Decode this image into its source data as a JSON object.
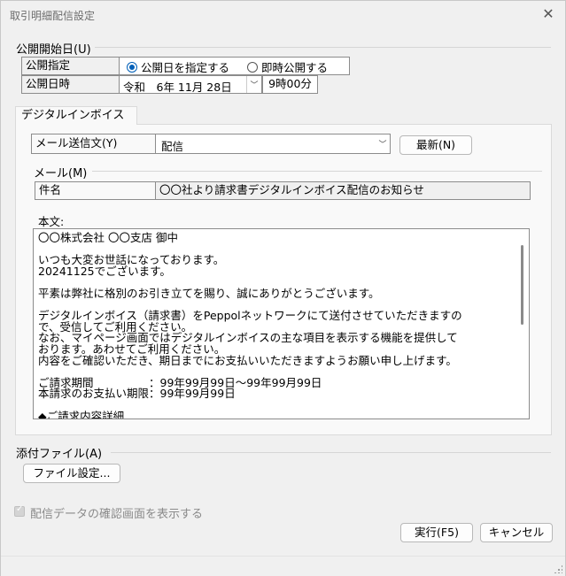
{
  "window": {
    "title": "取引明細配信設定"
  },
  "publish": {
    "group_label": "公開開始日(U)",
    "mode_label": "公開指定",
    "radio_specify": "公開日を指定する",
    "radio_immediate": "即時公開する",
    "date_label": "公開日時",
    "date_value": "令和　6年 11月 28日",
    "time_value": "9時00分"
  },
  "tab": {
    "label": "デジタルインボイス"
  },
  "mail": {
    "template_label": "メール送信文(Y)",
    "template_value": "配信",
    "refresh_button": "最新(N)",
    "group_label": "メール(M)",
    "subject_label": "件名",
    "subject_value": "〇〇社より請求書デジタルインボイス配信のお知らせ",
    "body_label": "本文:",
    "body_text": "〇〇株式会社 〇〇支店 御中\n\nいつも大変お世話になっております。\n20241125でございます。\n\n平素は弊社に格別のお引き立てを賜り、誠にありがとうございます。\n\nデジタルインボイス（請求書）をPeppolネットワークにて送付させていただきますの\nで、受信してご利用ください。\nなお、マイページ画面ではデジタルインボイスの主な項目を表示する機能を提供して\nおります。あわせてご利用ください。\n内容をご確認いただき、期日までにお支払いいただきますようお願い申し上げます。\n\nご請求期間　　　　　：99年99月99日～99年99月99日\n本請求のお支払い期限：99年99月99日\n\n◆ご請求内容詳細"
  },
  "attachment": {
    "group_label": "添付ファイル(A)",
    "settings_button": "ファイル設定..."
  },
  "confirm_checkbox_label": "配信データの確認画面を表示する",
  "footer": {
    "execute_button": "実行(F5)",
    "cancel_button": "キャンセル"
  },
  "colors": {
    "accent": "#005fb8",
    "border": "#8c8c8c",
    "background": "#f0f0f0"
  }
}
